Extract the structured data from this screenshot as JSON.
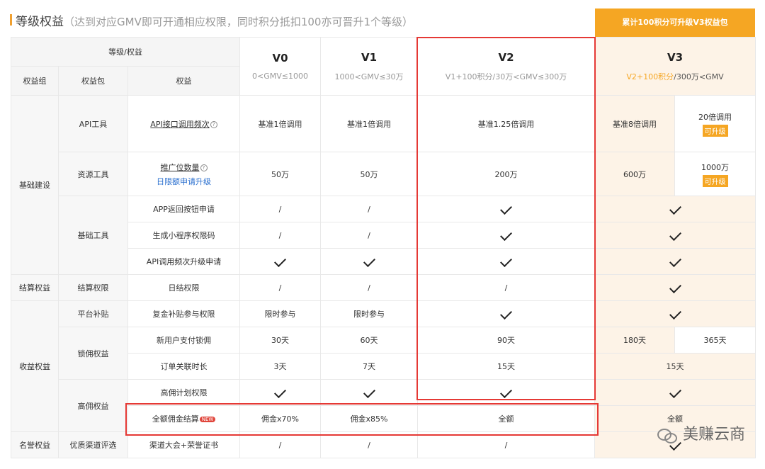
{
  "title": {
    "main": "等级权益",
    "sub": "（达到对应GMV即可开通相应权限，同时积分抵扣100亦可晋升1个等级）"
  },
  "promo_label": "累计100积分可升级V3权益包",
  "header": {
    "group_title": "等级/权益",
    "col_group": "权益组",
    "col_package": "权益包",
    "col_right": "权益",
    "levels": [
      {
        "name": "V0",
        "range": "0<GMV≤1000"
      },
      {
        "name": "V1",
        "range": "1000<GMV≤30万"
      },
      {
        "name": "V2",
        "range": "V1+100积分/30万<GMV≤300万"
      },
      {
        "name": "V3",
        "range_a": "V2+100积分",
        "range_b": "/300万<GMV"
      }
    ]
  },
  "groups": {
    "infra": "基础建设",
    "settle": "结算权益",
    "income": "收益权益",
    "honor": "名誉权益"
  },
  "packages": {
    "api": "API工具",
    "resource": "资源工具",
    "basic": "基础工具",
    "settle": "结算权限",
    "subsidy": "平台补贴",
    "lock": "锁佣权益",
    "high": "高佣权益",
    "channel": "优质渠道评选"
  },
  "rows": {
    "api_freq": {
      "label": "API接口调用频次",
      "v0": "基准1倍调用",
      "v1": "基准1倍调用",
      "v2": "基准1.25倍调用",
      "v3a": "基准8倍调用",
      "v3b": "20倍调用",
      "v3tag": "可升级"
    },
    "promo_pos": {
      "label": "推广位数量",
      "sub": "日限额申请升级",
      "v0": "50万",
      "v1": "50万",
      "v2": "200万",
      "v3a": "600万",
      "v3b": "1000万",
      "v3tag": "可升级"
    },
    "app_back": {
      "label": "APP返回按钮申请",
      "v0": "/",
      "v1": "/"
    },
    "mini_prog": {
      "label": "生成小程序权限码",
      "v0": "/",
      "v1": "/"
    },
    "api_upgrade": {
      "label": "API调用频次升级申请"
    },
    "daily_settle": {
      "label": "日结权限",
      "v0": "/",
      "v1": "/",
      "v2": "/"
    },
    "bonus": {
      "label": "复金补贴参与权限",
      "v0": "限时参与",
      "v1": "限时参与"
    },
    "new_user": {
      "label": "新用户支付锁佣",
      "v0": "30天",
      "v1": "60天",
      "v2": "90天",
      "v3a": "180天",
      "v3b": "365天"
    },
    "order_link": {
      "label": "订单关联时长",
      "v0": "3天",
      "v1": "7天",
      "v2": "15天",
      "v3": "15天"
    },
    "high_plan": {
      "label": "高佣计划权限"
    },
    "full_settle": {
      "label": "全额佣金结算",
      "badge": "NEW",
      "v0": "佣金x70%",
      "v1": "佣金x85%",
      "v2": "全额",
      "v3": "全额"
    },
    "channel_row": {
      "label": "渠道大会+荣誉证书",
      "v0": "/",
      "v1": "/",
      "v2": "/"
    }
  },
  "watermark": "美赚云商",
  "icons": [
    "check-icon",
    "question-icon",
    "wechat-icon"
  ],
  "colors": {
    "accent": "#f5a623",
    "highlight_border": "#e53935",
    "v3_bg": "#fdf3e7",
    "link": "#2a6fcf"
  }
}
